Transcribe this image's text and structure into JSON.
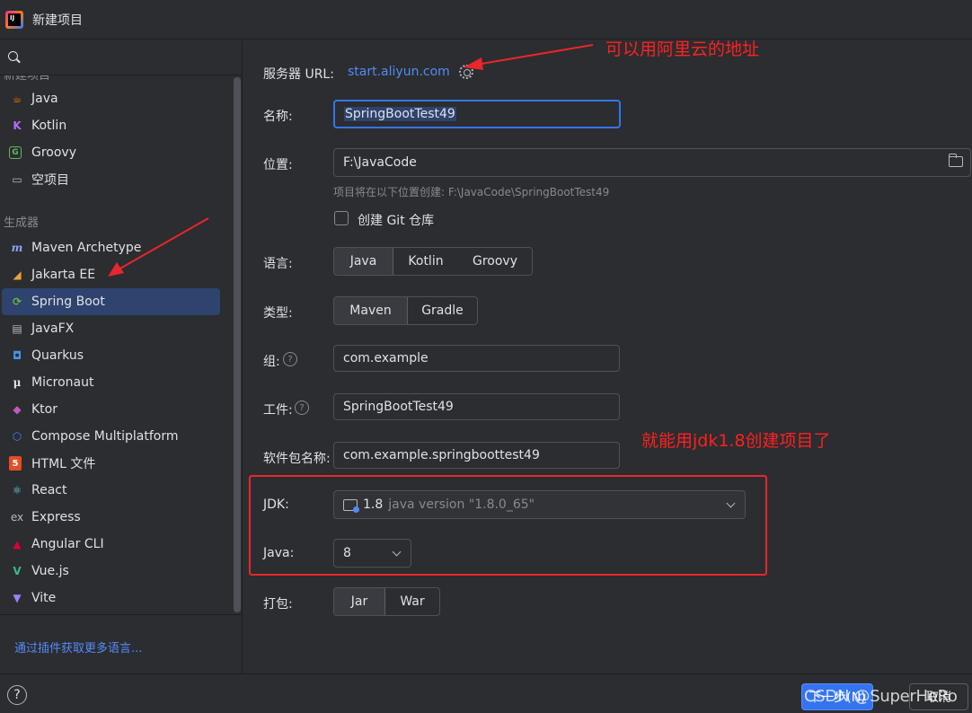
{
  "window": {
    "title": "新建项目"
  },
  "sidebar": {
    "cut_group_label": "新建项目",
    "generators_label": "生成器",
    "items": [
      {
        "label": "Java",
        "icon": "java-icon"
      },
      {
        "label": "Kotlin",
        "icon": "kotlin-icon"
      },
      {
        "label": "Groovy",
        "icon": "groovy-icon"
      },
      {
        "label": "空项目",
        "icon": "empty-project-icon"
      },
      {
        "label": "Maven Archetype",
        "icon": "maven-icon"
      },
      {
        "label": "Jakarta EE",
        "icon": "jakarta-icon"
      },
      {
        "label": "Spring Boot",
        "icon": "spring-boot-icon",
        "selected": true
      },
      {
        "label": "JavaFX",
        "icon": "javafx-icon"
      },
      {
        "label": "Quarkus",
        "icon": "quarkus-icon"
      },
      {
        "label": "Micronaut",
        "icon": "micronaut-icon"
      },
      {
        "label": "Ktor",
        "icon": "ktor-icon"
      },
      {
        "label": "Compose Multiplatform",
        "icon": "compose-icon"
      },
      {
        "label": "HTML 文件",
        "icon": "html-icon"
      },
      {
        "label": "React",
        "icon": "react-icon"
      },
      {
        "label": "Express",
        "icon": "express-icon"
      },
      {
        "label": "Angular CLI",
        "icon": "angular-icon"
      },
      {
        "label": "Vue.js",
        "icon": "vue-icon"
      },
      {
        "label": "Vite",
        "icon": "vite-icon"
      }
    ],
    "plugin_link": "通过插件获取更多语言..."
  },
  "form": {
    "server_url_label": "服务器 URL:",
    "server_url_value": "start.aliyun.com",
    "name_label": "名称:",
    "name_value": "SpringBootTest49",
    "location_label": "位置:",
    "location_value": "F:\\JavaCode",
    "location_hint": "项目将在以下位置创建: F:\\JavaCode\\SpringBootTest49",
    "git_checkbox_label": "创建 Git 仓库",
    "git_checked": false,
    "language_label": "语言:",
    "language_options": [
      "Java",
      "Kotlin",
      "Groovy"
    ],
    "language_selected": "Java",
    "type_label": "类型:",
    "type_options": [
      "Maven",
      "Gradle"
    ],
    "type_selected": "Maven",
    "group_label": "组:",
    "group_value": "com.example",
    "artifact_label": "工件:",
    "artifact_value": "SpringBootTest49",
    "package_label": "软件包名称:",
    "package_value": "com.example.springboottest49",
    "jdk_label": "JDK:",
    "jdk_version": "1.8",
    "jdk_detail": "java version \"1.8.0_65\"",
    "java_label": "Java:",
    "java_value": "8",
    "packaging_label": "打包:",
    "packaging_options": [
      "Jar",
      "War"
    ],
    "packaging_selected": "Jar"
  },
  "annotations": {
    "top_note": "可以用阿里云的地址",
    "jdk_note": "就能用jdk1.8创建项目了",
    "color": "#e8262b"
  },
  "footer": {
    "next_button": "下一步(N)",
    "cancel_button": "取消",
    "watermark": "CSDN @SuperHeRo"
  },
  "colors": {
    "background": "#2b2d30",
    "accent": "#3574f0",
    "link": "#548af7",
    "selection": "#2e436e"
  }
}
